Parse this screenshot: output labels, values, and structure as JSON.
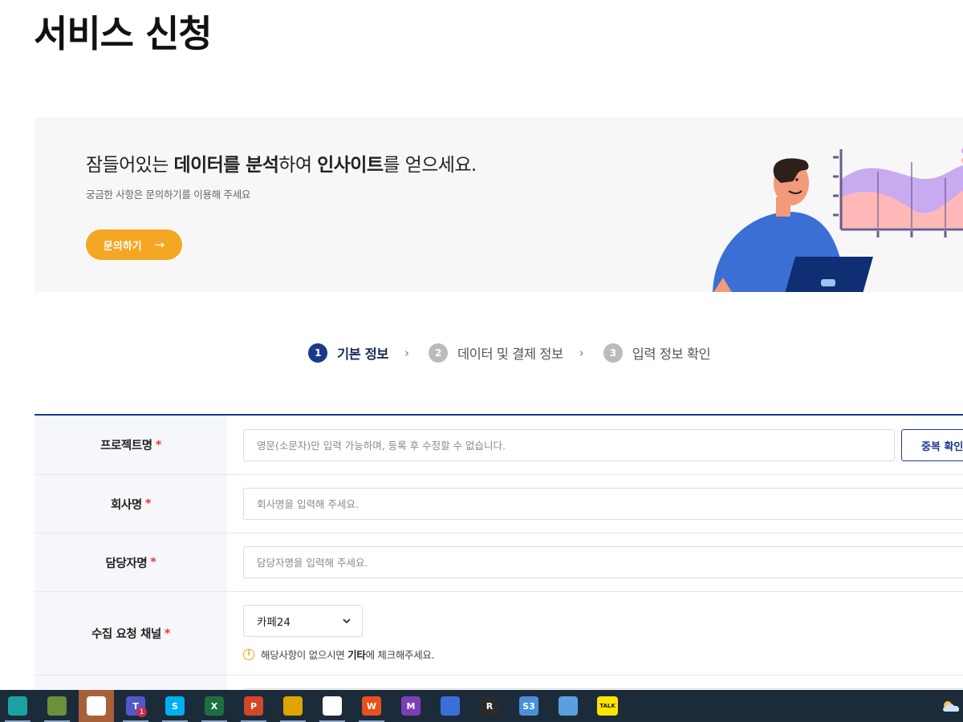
{
  "page": {
    "title": "서비스 신청"
  },
  "banner": {
    "headline_parts": [
      "잠들어있는 ",
      "데이터를 분석",
      "하여 ",
      "인사이트",
      "를 얻으세요."
    ],
    "subtitle": "궁금한 사항은 문의하기를 이용해 주세요",
    "button_label": "문의하기",
    "button_arrow": "→"
  },
  "steps": [
    {
      "num": "1",
      "label": "기본 정보",
      "active": true
    },
    {
      "num": "2",
      "label": "데이터 및 결제 정보",
      "active": false
    },
    {
      "num": "3",
      "label": "입력 정보 확인",
      "active": false
    }
  ],
  "step_separator": "›",
  "form": {
    "required_mark": "*",
    "project_name": {
      "label": "프로젝트명",
      "placeholder": "영문(소문자)만 입력 가능하며, 등록 후 수정할 수 없습니다.",
      "value": "",
      "check_button": "중복 확인"
    },
    "company_name": {
      "label": "회사명",
      "placeholder": "회사명을 입력해 주세요.",
      "value": ""
    },
    "manager_name": {
      "label": "담당자명",
      "placeholder": "담당자명을 입력해 주세요.",
      "value": ""
    },
    "channel": {
      "label": "수집 요청 채널",
      "selected": "카페24",
      "hint_before": "해당사항이 없으시면 ",
      "hint_bold": "기타",
      "hint_after": "에 체크해주세요."
    }
  },
  "taskbar": {
    "apps": [
      {
        "name": "edge-app",
        "label": "",
        "color": "#1aa3a3",
        "active": false
      },
      {
        "name": "notepad-app",
        "label": "",
        "color": "#6b8f3a",
        "active": false
      },
      {
        "name": "slack-app",
        "label": "",
        "color": "#ffffff",
        "active": true
      },
      {
        "name": "teams-app",
        "label": "T",
        "color": "#5059c9",
        "active": false,
        "badge": "1"
      },
      {
        "name": "skype-app",
        "label": "S",
        "color": "#00aff0",
        "active": false
      },
      {
        "name": "excel-app",
        "label": "X",
        "color": "#1d6f42",
        "active": false
      },
      {
        "name": "powerpoint-app",
        "label": "P",
        "color": "#d24726",
        "active": false
      },
      {
        "name": "chart-app",
        "label": "",
        "color": "#e0a400",
        "active": false
      },
      {
        "name": "paint-app",
        "label": "",
        "color": "#ffffff",
        "active": false
      },
      {
        "name": "w-app",
        "label": "W",
        "color": "#e8501e",
        "active": false
      },
      {
        "name": "m-app",
        "label": "M",
        "color": "#7b3fb5",
        "active": false
      },
      {
        "name": "network-app",
        "label": "",
        "color": "#3a6fd8",
        "active": false
      },
      {
        "name": "r-app",
        "label": "R",
        "color": "#2a2a2a",
        "active": false
      },
      {
        "name": "s3-app",
        "label": "S3",
        "color": "#4a90d9",
        "active": false
      },
      {
        "name": "remote-app",
        "label": "",
        "color": "#5aa0e0",
        "active": false
      },
      {
        "name": "kakaotalk-app",
        "label": "TALK",
        "color": "#fee500",
        "active": false
      }
    ]
  }
}
